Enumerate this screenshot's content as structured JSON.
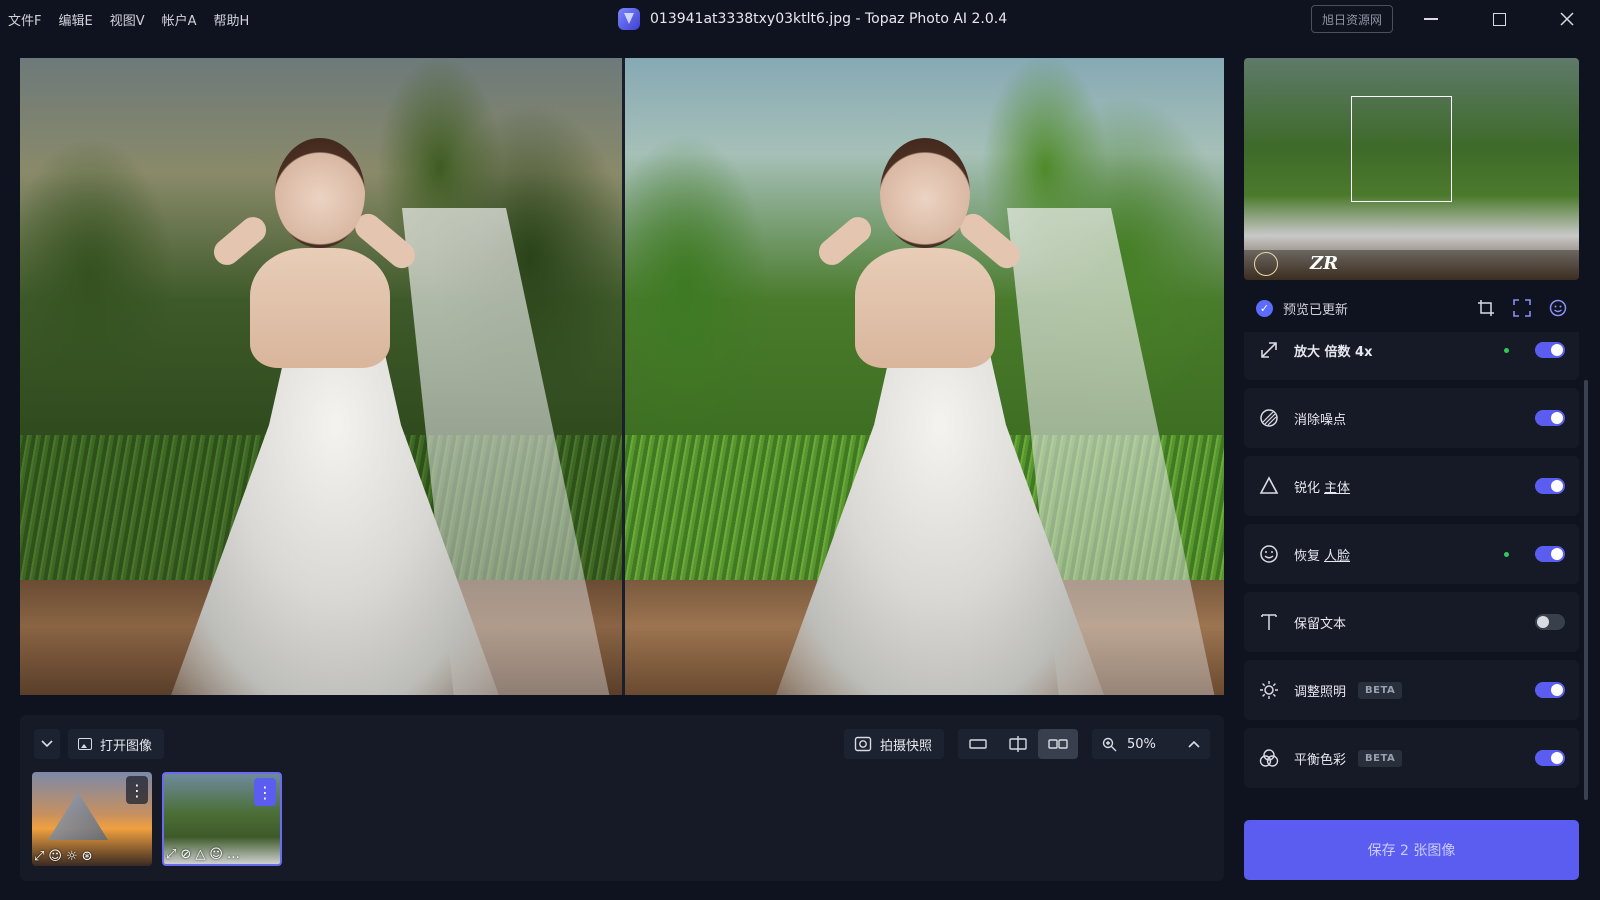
{
  "menu": [
    "文件F",
    "编辑E",
    "视图V",
    "帐户A",
    "帮助H"
  ],
  "window": {
    "title": "013941at3338txy03ktlt6.jpg - Topaz Photo AI 2.0.4",
    "watermark": "旭日资源网"
  },
  "filmstrip": {
    "open_label": "打开图像",
    "snapshot_label": "拍摄快照",
    "zoom": "50%",
    "thumbs": [
      {
        "icons": [
          "⤢",
          "☺",
          "☼",
          "⊛"
        ]
      },
      {
        "icons": [
          "⤢",
          "⊘",
          "△",
          "☺",
          "…"
        ]
      }
    ]
  },
  "preview": {
    "status": "预览已更新"
  },
  "navigator": {
    "brand_mark": "ZR"
  },
  "options": [
    {
      "label": "放大 倍数 4x",
      "sub": "",
      "beta": "",
      "enabled": true,
      "dot": true,
      "icon": "upscale-icon"
    },
    {
      "label": "消除噪点",
      "sub": "",
      "beta": "",
      "enabled": true,
      "dot": false,
      "icon": "denoise-icon"
    },
    {
      "label": "锐化",
      "sub": "主体",
      "beta": "",
      "enabled": true,
      "dot": false,
      "icon": "sharpen-icon"
    },
    {
      "label": "恢复",
      "sub": "人脸",
      "beta": "",
      "enabled": true,
      "dot": true,
      "icon": "face-icon"
    },
    {
      "label": "保留文本",
      "sub": "",
      "beta": "",
      "enabled": false,
      "dot": false,
      "icon": "text-icon"
    },
    {
      "label": "调整照明",
      "sub": "",
      "beta": "BETA",
      "enabled": true,
      "dot": false,
      "icon": "lighting-icon"
    },
    {
      "label": "平衡色彩",
      "sub": "",
      "beta": "BETA",
      "enabled": true,
      "dot": false,
      "icon": "color-icon"
    }
  ],
  "save_label": "保存 2 张图像",
  "colors": {
    "accent": "#5b5df0",
    "background": "#0f1320",
    "panel": "#161a26",
    "status_dot": "#34c759"
  }
}
